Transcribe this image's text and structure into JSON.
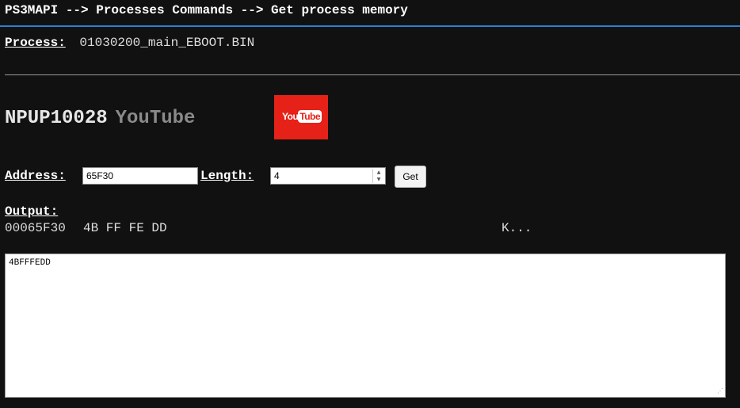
{
  "header": {
    "title": "PS3MAPI --> Processes Commands --> Get process memory",
    "accent_color": "#2f7fd0"
  },
  "process": {
    "label": "Process:",
    "value": "01030200_main_EBOOT.BIN"
  },
  "game": {
    "id": "NPUP10028",
    "name": "YouTube",
    "logo": {
      "icon": "youtube-logo-icon",
      "text_you": "You",
      "text_tube": "Tube",
      "color": "#e62117"
    }
  },
  "form": {
    "address_label": "Address:",
    "address_value": "65F30",
    "length_label": "Length:",
    "length_value": "4",
    "get_label": "Get"
  },
  "output": {
    "label": "Output:",
    "address": "00065F30",
    "bytes": "4B FF FE DD",
    "ascii": "K...",
    "text": "4BFFFEDD"
  }
}
